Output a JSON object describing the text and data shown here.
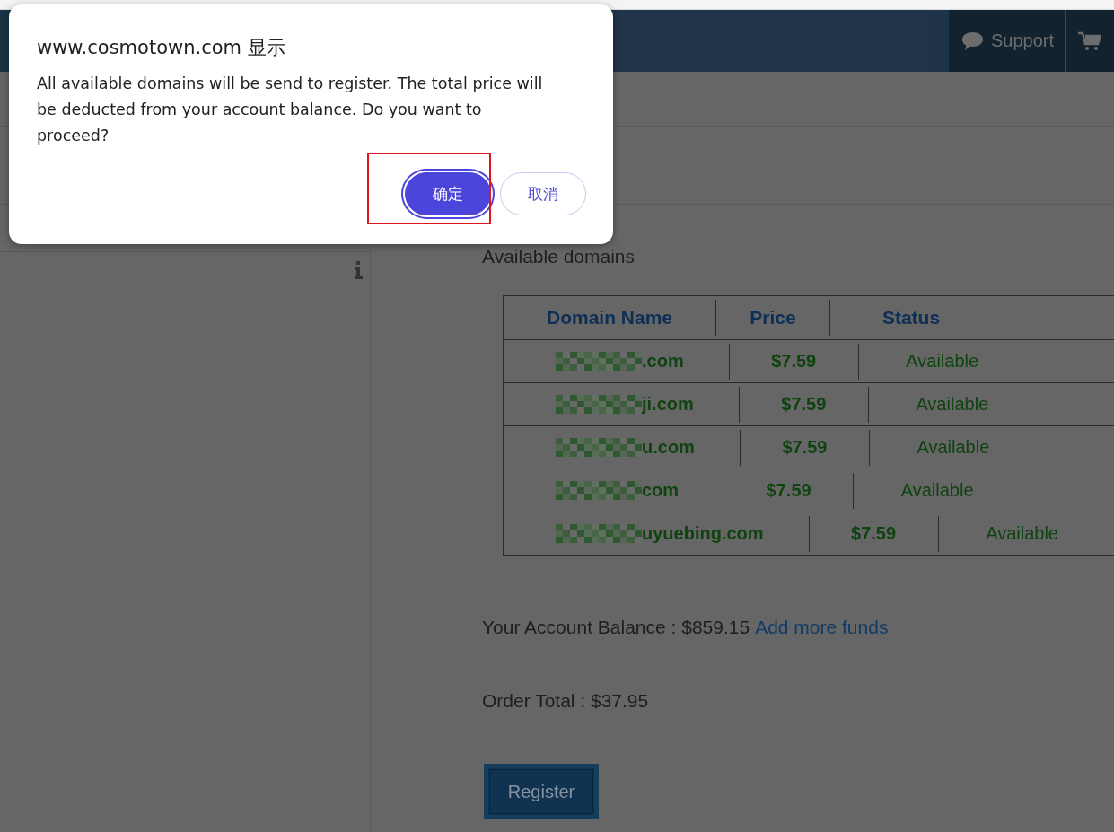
{
  "header": {
    "support": "Support"
  },
  "available_heading": "Available domains",
  "table": {
    "columns": [
      "Domain Name",
      "Price",
      "Status"
    ],
    "rows": [
      {
        "domain": ".com",
        "price": "$7.59",
        "status": "Available"
      },
      {
        "domain": "ji.com",
        "price": "$7.59",
        "status": "Available"
      },
      {
        "domain": "u.com",
        "price": "$7.59",
        "status": "Available"
      },
      {
        "domain": "com",
        "price": "$7.59",
        "status": "Available"
      },
      {
        "domain": "uyuebing.com",
        "price": "$7.59",
        "status": "Available"
      }
    ]
  },
  "balance": {
    "label": "Your Account Balance : $859.15",
    "link": "Add more funds"
  },
  "order_total": "Order Total : $37.95",
  "register_button": "Register",
  "dialog": {
    "title": "www.cosmotown.com 显示",
    "message": "All available domains will be send to register. The total price will be deducted from your account balance. Do you want to proceed?",
    "buttons": [
      {
        "label": "确定",
        "kind": "primary",
        "focused": true
      },
      {
        "label": "取消",
        "kind": "secondary",
        "focused": false
      }
    ]
  }
}
